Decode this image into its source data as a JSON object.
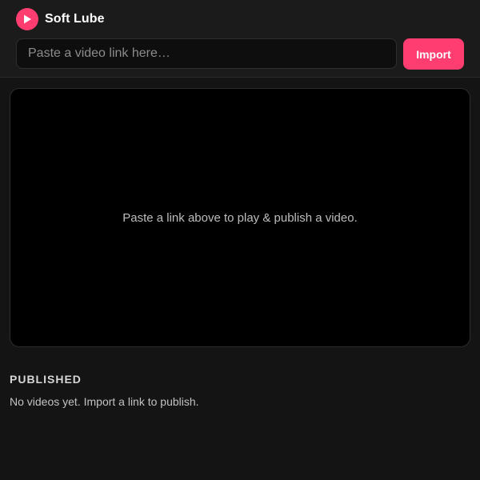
{
  "app": {
    "name": "Soft Lube",
    "logo_icon": "play-icon",
    "accent_color": "#ff3d71"
  },
  "import_bar": {
    "placeholder": "Paste a video link here…",
    "value": "",
    "button_label": "Import"
  },
  "player": {
    "empty_message": "Paste a link above to play & publish a video."
  },
  "published": {
    "title": "PUBLISHED",
    "empty_message": "No videos yet. Import a link to publish.",
    "items": []
  }
}
